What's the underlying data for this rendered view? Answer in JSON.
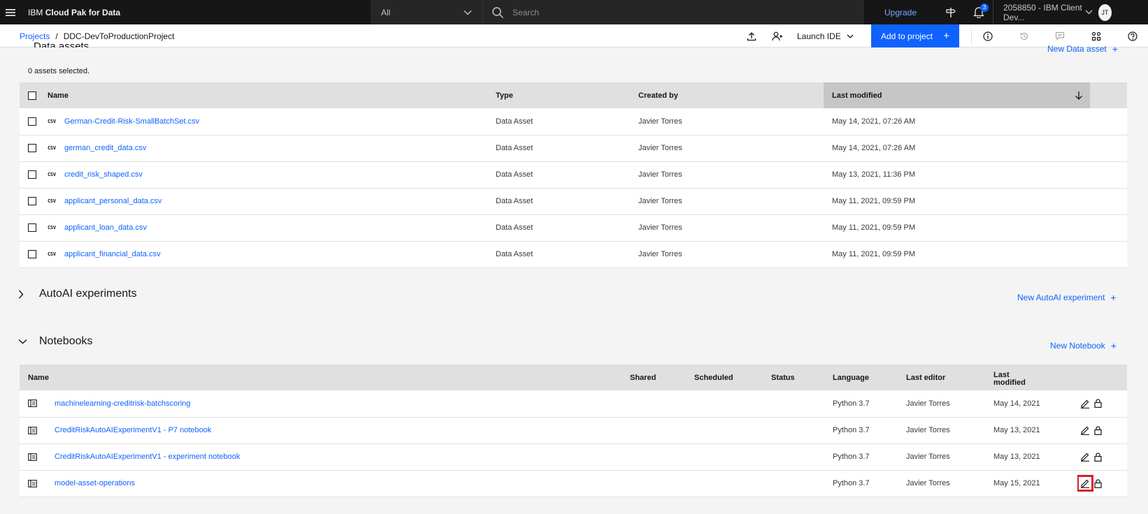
{
  "topbar": {
    "brand_prefix": "IBM",
    "brand_name": "Cloud Pak for Data",
    "scope": "All",
    "search_placeholder": "Search",
    "upgrade": "Upgrade",
    "notification_count": "3",
    "account": "2058850 - IBM Client Dev...",
    "avatar_initials": "JT"
  },
  "subbar": {
    "breadcrumb_root": "Projects",
    "breadcrumb_sep": "/",
    "project_name": "DDC-DevToProductionProject",
    "launch_ide": "Launch IDE",
    "add_to_project": "Add to project",
    "add_plus": "+"
  },
  "data_assets": {
    "title": "Data assets",
    "new_link": "New Data asset",
    "selected": "0 assets selected.",
    "columns": {
      "name": "Name",
      "type": "Type",
      "created_by": "Created by",
      "last_modified": "Last modified"
    },
    "rows": [
      {
        "icon": "CSV",
        "name": "German-Credit-Risk-SmallBatchSet.csv",
        "type": "Data Asset",
        "created_by": "Javier Torres",
        "last_modified": "May 14, 2021, 07:26 AM"
      },
      {
        "icon": "CSV",
        "name": "german_credit_data.csv",
        "type": "Data Asset",
        "created_by": "Javier Torres",
        "last_modified": "May 14, 2021, 07:26 AM"
      },
      {
        "icon": "CSV",
        "name": "credit_risk_shaped.csv",
        "type": "Data Asset",
        "created_by": "Javier Torres",
        "last_modified": "May 13, 2021, 11:36 PM"
      },
      {
        "icon": "CSV",
        "name": "applicant_personal_data.csv",
        "type": "Data Asset",
        "created_by": "Javier Torres",
        "last_modified": "May 11, 2021, 09:59 PM"
      },
      {
        "icon": "CSV",
        "name": "applicant_loan_data.csv",
        "type": "Data Asset",
        "created_by": "Javier Torres",
        "last_modified": "May 11, 2021, 09:59 PM"
      },
      {
        "icon": "CSV",
        "name": "applicant_financial_data.csv",
        "type": "Data Asset",
        "created_by": "Javier Torres",
        "last_modified": "May 11, 2021, 09:59 PM"
      }
    ]
  },
  "autoai": {
    "title": "AutoAI experiments",
    "new_link": "New AutoAI experiment"
  },
  "notebooks": {
    "title": "Notebooks",
    "new_link": "New Notebook",
    "columns": {
      "name": "Name",
      "shared": "Shared",
      "scheduled": "Scheduled",
      "status": "Status",
      "language": "Language",
      "last_editor": "Last editor",
      "last_modified_1": "Last",
      "last_modified_2": "modified"
    },
    "rows": [
      {
        "name": "machinelearning-creditrisk-batchscoring",
        "language": "Python 3.7",
        "last_editor": "Javier Torres",
        "last_modified": "May 14, 2021"
      },
      {
        "name": "CreditRiskAutoAIExperimentV1 - P7 notebook",
        "language": "Python 3.7",
        "last_editor": "Javier Torres",
        "last_modified": "May 13, 2021"
      },
      {
        "name": "CreditRiskAutoAIExperimentV1 - experiment notebook",
        "language": "Python 3.7",
        "last_editor": "Javier Torres",
        "last_modified": "May 13, 2021"
      },
      {
        "name": "model-asset-operations",
        "language": "Python 3.7",
        "last_editor": "Javier Torres",
        "last_modified": "May 15, 2021"
      }
    ]
  },
  "colors": {
    "accent": "#0f62fe",
    "topbar": "#161616",
    "highlight": "#da1e28"
  }
}
